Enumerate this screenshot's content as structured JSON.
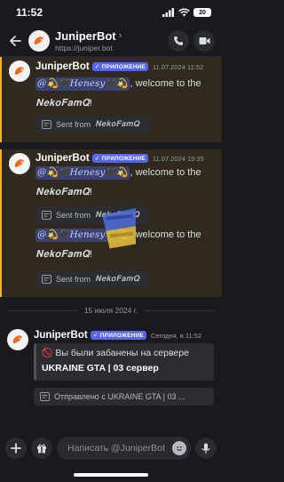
{
  "status_bar": {
    "time": "11:52",
    "battery": "20"
  },
  "header": {
    "title": "JuniperBot",
    "url": "https://juniper.bot",
    "back_icon": "arrow-left-icon",
    "call_icon": "phone-icon",
    "video_icon": "video-icon"
  },
  "messages": [
    {
      "author": "JuniperBot",
      "badge": "ПРИЛОЖЕНИЕ",
      "timestamp": "11.07.2024 11:52",
      "mention": "@💫🖤𝐻𝑒𝑛𝑒𝑠𝑦🖤💫",
      "text": ", welcome to the",
      "server": "𝐍𝐞𝐤𝐨𝐅𝐚𝐦𝐐",
      "after": "!",
      "sent_from": "Sent from",
      "sent_server": "𝐍𝐞𝐤𝐨𝐅𝐚𝐦𝐐"
    },
    {
      "author": "JuniperBot",
      "badge": "ПРИЛОЖЕНИЕ",
      "timestamp": "11.07.2024 19:35",
      "mention": "@💫🖤𝐻𝑒𝑛𝑒𝑠𝑦🖤💫",
      "text": ", welcome to the",
      "server": "𝐍𝐞𝐤𝐨𝐅𝐚𝐦𝐐",
      "after": "!",
      "sent_from": "Sent from",
      "sent_server": "𝐍𝐞𝐤𝐨𝐅𝐚𝐦𝐐"
    },
    {
      "mention": "@💫🖤𝐻𝑒𝑛𝑒𝑠𝑦🖤💫",
      "text": ", welcome to the",
      "server": "𝐍𝐞𝐤𝐨𝐅𝐚𝐦𝐐",
      "after": "!",
      "sent_from": "Sent from",
      "sent_server": "𝐍𝐞𝐤𝐨𝐅𝐚𝐦𝐐"
    }
  ],
  "date_divider": "15 июля 2024 г.",
  "ban_message": {
    "author": "JuniperBot",
    "badge": "ПРИЛОЖЕНИЕ",
    "timestamp": "Сегодня, в 11:52",
    "line1": "Вы были забанены на сервере",
    "line2": "UKRAINE GTA | 03 сервер",
    "sent_from": "Отправлено с UKRAINE GTA | 03 ..."
  },
  "input": {
    "placeholder": "Написать @JuniperBot"
  },
  "colors": {
    "background": "#1a1a1e",
    "mention_highlight": "#f0b232",
    "badge": "#5865f2",
    "mention_pill": "#3c4270"
  }
}
